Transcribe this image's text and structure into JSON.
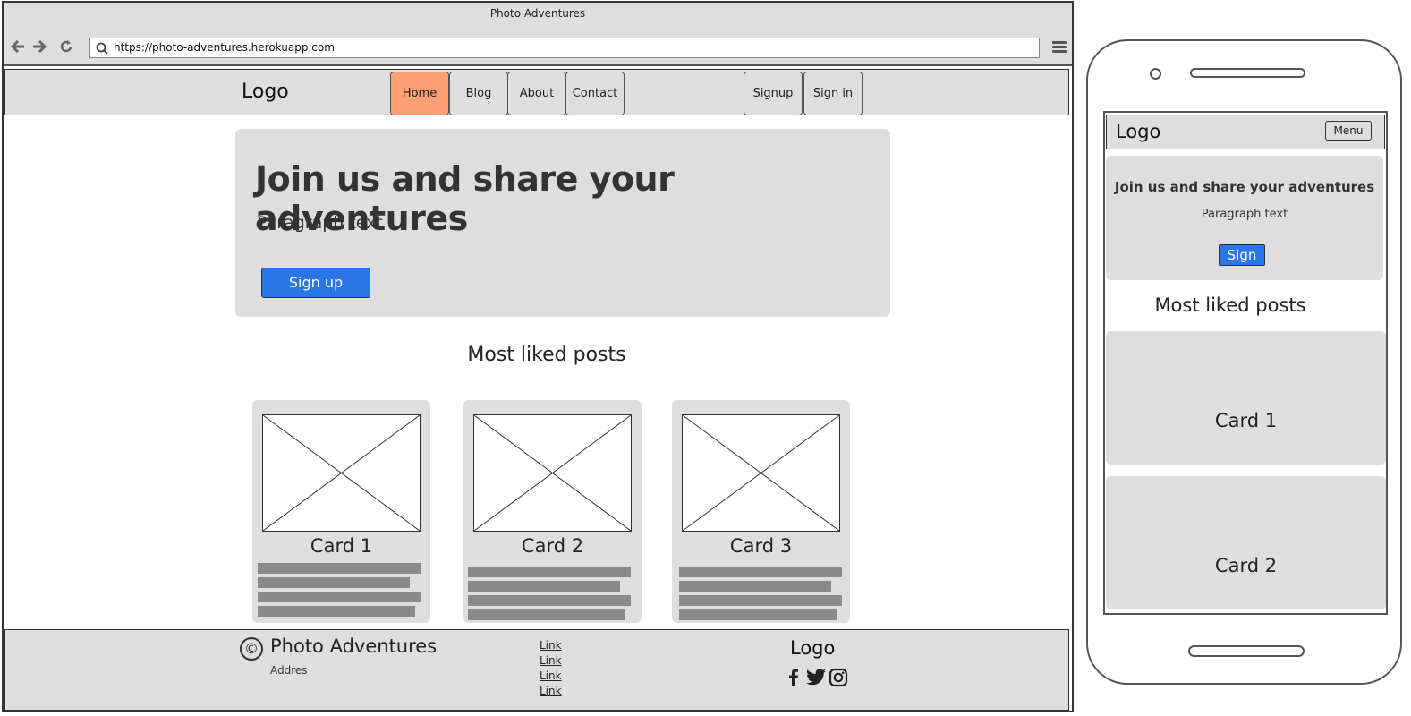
{
  "browser": {
    "title": "Photo Adventures",
    "url": "https://photo-adventures.herokuapp.com"
  },
  "navbar": {
    "logo": "Logo",
    "links": [
      {
        "label": "Home",
        "active": true
      },
      {
        "label": "Blog"
      },
      {
        "label": "About"
      },
      {
        "label": "Contact"
      }
    ],
    "auth": [
      {
        "label": "Signup"
      },
      {
        "label": "Sign in"
      }
    ]
  },
  "hero": {
    "heading": "Join us and share your adventures",
    "paragraph": "Paragraph text",
    "button": "Sign up"
  },
  "section_title": "Most liked posts",
  "cards": [
    {
      "title": "Card 1"
    },
    {
      "title": "Card 2"
    },
    {
      "title": "Card 3"
    }
  ],
  "footer": {
    "copyright_symbol": "©",
    "brand": "Photo Adventures",
    "address": "Addres",
    "links": [
      "Link",
      "Link",
      "Link",
      "Link"
    ],
    "logo": "Logo",
    "social_icons": [
      "facebook-icon",
      "twitter-icon",
      "instagram-icon"
    ]
  },
  "mobile": {
    "logo": "Logo",
    "menu_button": "Menu",
    "hero_heading": "Join us and share your adventures",
    "hero_paragraph": "Paragraph text",
    "hero_button": "Sign",
    "section_title": "Most liked posts",
    "cards": [
      {
        "title": "Card 1"
      },
      {
        "title": "Card 2"
      }
    ]
  },
  "colors": {
    "active_nav": "#ff9f74",
    "primary_button": "#2a76e6",
    "panel_gray": "#dedede",
    "placeholder_line": "#8a8a8a"
  }
}
